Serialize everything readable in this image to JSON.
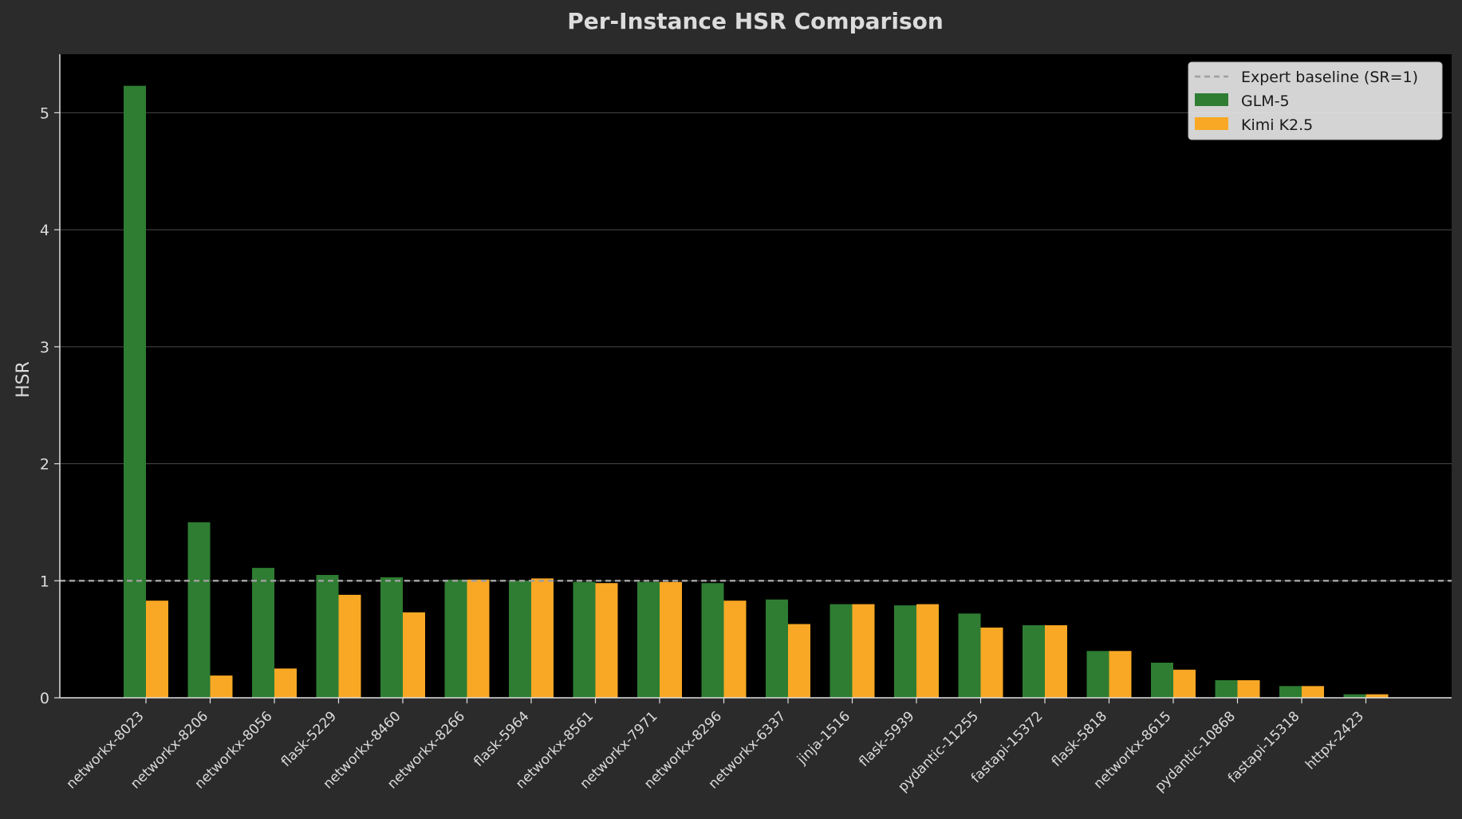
{
  "chart_data": {
    "type": "bar",
    "title": "Per-Instance HSR Comparison",
    "xlabel": "",
    "ylabel": "HSR",
    "ylim": [
      0,
      5.5
    ],
    "yticks": [
      0,
      1,
      2,
      3,
      4,
      5
    ],
    "grid": "horizontal",
    "legend_position": "top-right",
    "categories": [
      "networkx-8023",
      "networkx-8206",
      "networkx-8056",
      "flask-5229",
      "networkx-8460",
      "networkx-8266",
      "flask-5964",
      "networkx-8561",
      "networkx-7971",
      "networkx-8296",
      "networkx-6337",
      "jinja-1516",
      "flask-5939",
      "pydantic-11255",
      "fastapi-15372",
      "flask-5818",
      "networkx-8615",
      "pydantic-10868",
      "fastapi-15318",
      "httpx-2423"
    ],
    "series": [
      {
        "name": "GLM-5",
        "color": "#2e7d32",
        "values": [
          5.23,
          1.5,
          1.11,
          1.05,
          1.03,
          1.01,
          1.0,
          0.99,
          0.99,
          0.98,
          0.84,
          0.8,
          0.79,
          0.72,
          0.62,
          0.4,
          0.3,
          0.15,
          0.1,
          0.03
        ]
      },
      {
        "name": "Kimi K2.5",
        "color": "#f9a825",
        "values": [
          0.83,
          0.19,
          0.25,
          0.88,
          0.73,
          1.01,
          1.02,
          0.98,
          0.99,
          0.83,
          0.63,
          0.8,
          0.8,
          0.6,
          0.62,
          0.4,
          0.24,
          0.15,
          0.1,
          0.03
        ]
      }
    ],
    "baseline": {
      "name": "Expert baseline (SR=1)",
      "value": 1,
      "color": "#9e9e9e"
    }
  }
}
